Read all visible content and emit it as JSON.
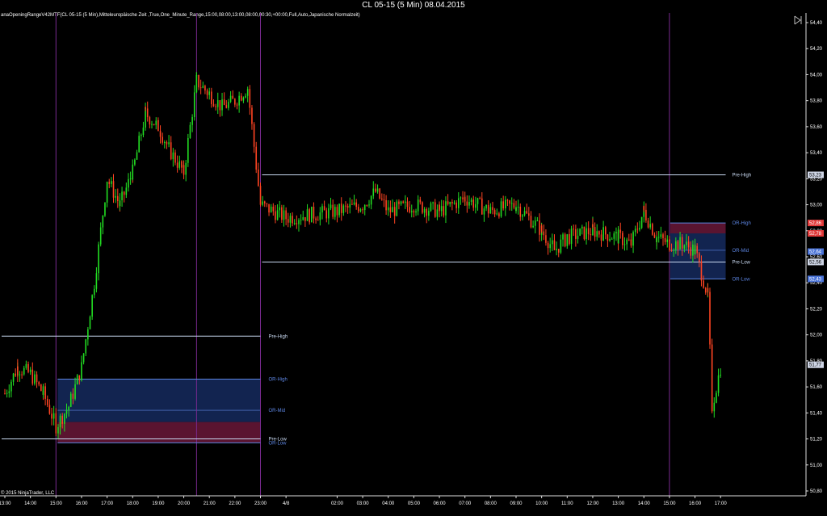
{
  "window": {
    "title": "CL 05-15 (5 Min)  08.04.2015"
  },
  "indicator_text": "anaOpeningRangeV42MTF(CL 05-15 (5 Min),Mitteleuropäische Zeit ,True,One_Minute_Range,15:00,08:00,13:00,08:00,00:30,+00:00,Full,Auto,Japanische Normalzeit)",
  "copyright": "© 2015 NinjaTrader, LLC",
  "colors": {
    "background": "#000000",
    "up_candle": "#22dd22",
    "down_candle": "#ff4422",
    "session_line": "#7a2a90",
    "pre_level": "#c8d8f0",
    "or_level": "#5c84e0",
    "upper_box": "#122450",
    "lower_box": "#5a1430"
  },
  "icons": {
    "panel_toggle": "collapse-panel-icon"
  },
  "chart_data": {
    "type": "candlestick",
    "timeframe": "5 Min",
    "y_range": [
      50.8,
      54.5
    ],
    "y_ticks": [
      "54,40",
      "54,20",
      "54,00",
      "53,80",
      "53,60",
      "53,40",
      "53,20",
      "53,00",
      "52,80",
      "52,60",
      "52,40",
      "52,20",
      "52,00",
      "51,80",
      "51,60",
      "51,40",
      "51,20",
      "51,00",
      "50,80"
    ],
    "x_ticks": [
      "13:00",
      "14:00",
      "15:00",
      "16:00",
      "17:00",
      "18:00",
      "19:00",
      "20:00",
      "21:00",
      "22:00",
      "23:00",
      "4/8",
      "02:00",
      "03:00",
      "04:00",
      "05:00",
      "06:00",
      "07:00",
      "08:00",
      "09:00",
      "10:00",
      "11:00",
      "12:00",
      "13:00",
      "14:00",
      "15:00",
      "16:00",
      "17:00"
    ],
    "price_tags": [
      {
        "label": "53,23",
        "value": 53.23,
        "style": "gray"
      },
      {
        "label": "52,86",
        "value": 52.86,
        "style": "red"
      },
      {
        "label": "52,78",
        "value": 52.78,
        "style": "red"
      },
      {
        "label": "52,64",
        "value": 52.64,
        "style": "blue"
      },
      {
        "label": "52,56",
        "value": 52.56,
        "style": "gray"
      },
      {
        "label": "52,43",
        "value": 52.43,
        "style": "blue"
      },
      {
        "label": "51,77",
        "value": 51.77,
        "style": "gray"
      }
    ],
    "session_markers": [
      "15:00",
      "20:30",
      "23:00",
      "15:00"
    ],
    "levels": [
      {
        "label": "Pre-High",
        "value": 53.23,
        "kind": "pre",
        "session": 2
      },
      {
        "label": "OR-High",
        "value": 52.86,
        "kind": "or",
        "session": 2
      },
      {
        "label": "OR-Mid",
        "value": 52.65,
        "kind": "or",
        "session": 2
      },
      {
        "label": "Pre-Low",
        "value": 52.56,
        "kind": "pre",
        "session": 2
      },
      {
        "label": "OR-Low",
        "value": 52.43,
        "kind": "or",
        "session": 2
      },
      {
        "label": "Pre-High",
        "value": 51.99,
        "kind": "pre",
        "session": 1
      },
      {
        "label": "OR-High",
        "value": 51.66,
        "kind": "or",
        "session": 1
      },
      {
        "label": "OR-Mid",
        "value": 51.42,
        "kind": "or",
        "session": 1
      },
      {
        "label": "Pre-Low",
        "value": 51.2,
        "kind": "pre",
        "session": 1
      },
      {
        "label": "OR-Low",
        "value": 51.17,
        "kind": "or",
        "session": 1
      }
    ],
    "path": [
      [
        "13:00",
        51.55
      ],
      [
        "13:30",
        51.75
      ],
      [
        "14:00",
        51.7
      ],
      [
        "14:30",
        51.55
      ],
      [
        "15:00",
        51.3
      ],
      [
        "15:30",
        51.45
      ],
      [
        "16:00",
        51.75
      ],
      [
        "16:30",
        52.4
      ],
      [
        "17:00",
        53.2
      ],
      [
        "17:30",
        53.0
      ],
      [
        "18:00",
        53.25
      ],
      [
        "18:30",
        53.7
      ],
      [
        "19:00",
        53.6
      ],
      [
        "19:30",
        53.4
      ],
      [
        "20:00",
        53.25
      ],
      [
        "20:30",
        53.95
      ],
      [
        "21:00",
        53.85
      ],
      [
        "21:30",
        53.75
      ],
      [
        "22:00",
        53.8
      ],
      [
        "22:30",
        53.9
      ],
      [
        "23:00",
        53.0
      ],
      [
        "23:30",
        52.95
      ],
      [
        "4/8",
        52.9
      ],
      [
        "02:00",
        52.95
      ],
      [
        "03:00",
        53.0
      ],
      [
        "03:30",
        53.1
      ],
      [
        "04:00",
        52.95
      ],
      [
        "05:00",
        53.0
      ],
      [
        "06:00",
        52.95
      ],
      [
        "07:00",
        53.05
      ],
      [
        "08:00",
        52.95
      ],
      [
        "09:00",
        53.0
      ],
      [
        "10:00",
        52.8
      ],
      [
        "10:30",
        52.65
      ],
      [
        "11:00",
        52.75
      ],
      [
        "12:00",
        52.8
      ],
      [
        "13:00",
        52.75
      ],
      [
        "13:30",
        52.7
      ],
      [
        "14:00",
        52.95
      ],
      [
        "14:30",
        52.75
      ],
      [
        "15:00",
        52.7
      ],
      [
        "15:30",
        52.7
      ],
      [
        "16:00",
        52.65
      ],
      [
        "16:30",
        52.3
      ],
      [
        "16:40",
        51.45
      ],
      [
        "17:00",
        51.75
      ],
      [
        "17:10",
        51.77
      ]
    ]
  }
}
